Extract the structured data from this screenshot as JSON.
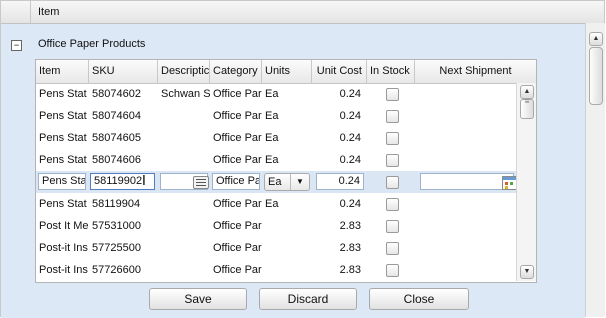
{
  "outer_grid": {
    "header": "Item",
    "group": {
      "label": "Office Paper Products",
      "expander": "−"
    }
  },
  "detail_grid": {
    "columns": [
      "Item",
      "SKU",
      "Descriptic",
      "Category",
      "Units",
      "Unit Cost",
      "In Stock",
      "Next Shipment"
    ],
    "rows": [
      {
        "item": "Pens Stat",
        "sku": "58074602",
        "description": "Schwan S",
        "category": "Office Par",
        "units": "Ea",
        "unit_cost": "0.24",
        "in_stock": false,
        "next_shipment": ""
      },
      {
        "item": "Pens Stat",
        "sku": "58074604",
        "description": "",
        "category": "Office Par",
        "units": "Ea",
        "unit_cost": "0.24",
        "in_stock": false,
        "next_shipment": ""
      },
      {
        "item": "Pens Stat",
        "sku": "58074605",
        "description": "",
        "category": "Office Par",
        "units": "Ea",
        "unit_cost": "0.24",
        "in_stock": false,
        "next_shipment": ""
      },
      {
        "item": "Pens Stat",
        "sku": "58074606",
        "description": "",
        "category": "Office Par",
        "units": "Ea",
        "unit_cost": "0.24",
        "in_stock": false,
        "next_shipment": ""
      },
      {
        "item": "Pens Sta",
        "sku": "58119902",
        "description": "",
        "category": "Office Pa",
        "units": "Ea",
        "unit_cost": "0.24",
        "in_stock": false,
        "next_shipment": "",
        "editing": true
      },
      {
        "item": "Pens Stat",
        "sku": "58119904",
        "description": "",
        "category": "Office Par",
        "units": "Ea",
        "unit_cost": "0.24",
        "in_stock": false,
        "next_shipment": ""
      },
      {
        "item": "Post It Me",
        "sku": "57531000",
        "description": "",
        "category": "Office Par",
        "units": "",
        "unit_cost": "2.83",
        "in_stock": false,
        "next_shipment": ""
      },
      {
        "item": "Post-it Ins",
        "sku": "57725500",
        "description": "",
        "category": "Office Par",
        "units": "",
        "unit_cost": "2.83",
        "in_stock": false,
        "next_shipment": ""
      },
      {
        "item": "Post-it Ins",
        "sku": "57726600",
        "description": "",
        "category": "Office Par",
        "units": "",
        "unit_cost": "2.83",
        "in_stock": false,
        "next_shipment": ""
      }
    ]
  },
  "icons": {
    "scroll_up": "▲",
    "scroll_down": "▼",
    "dropdown": "▼",
    "text_cursor": "I",
    "grip": "≡",
    "calendar": "calendar-icon",
    "editor": "text-editor-icon"
  },
  "buttons": {
    "save": "Save",
    "discard": "Discard",
    "close": "Close"
  },
  "colors": {
    "selected_group": "#dde8f6",
    "editing_row": "#dbe6f5",
    "calendar_accent": "#6a9ad4"
  }
}
